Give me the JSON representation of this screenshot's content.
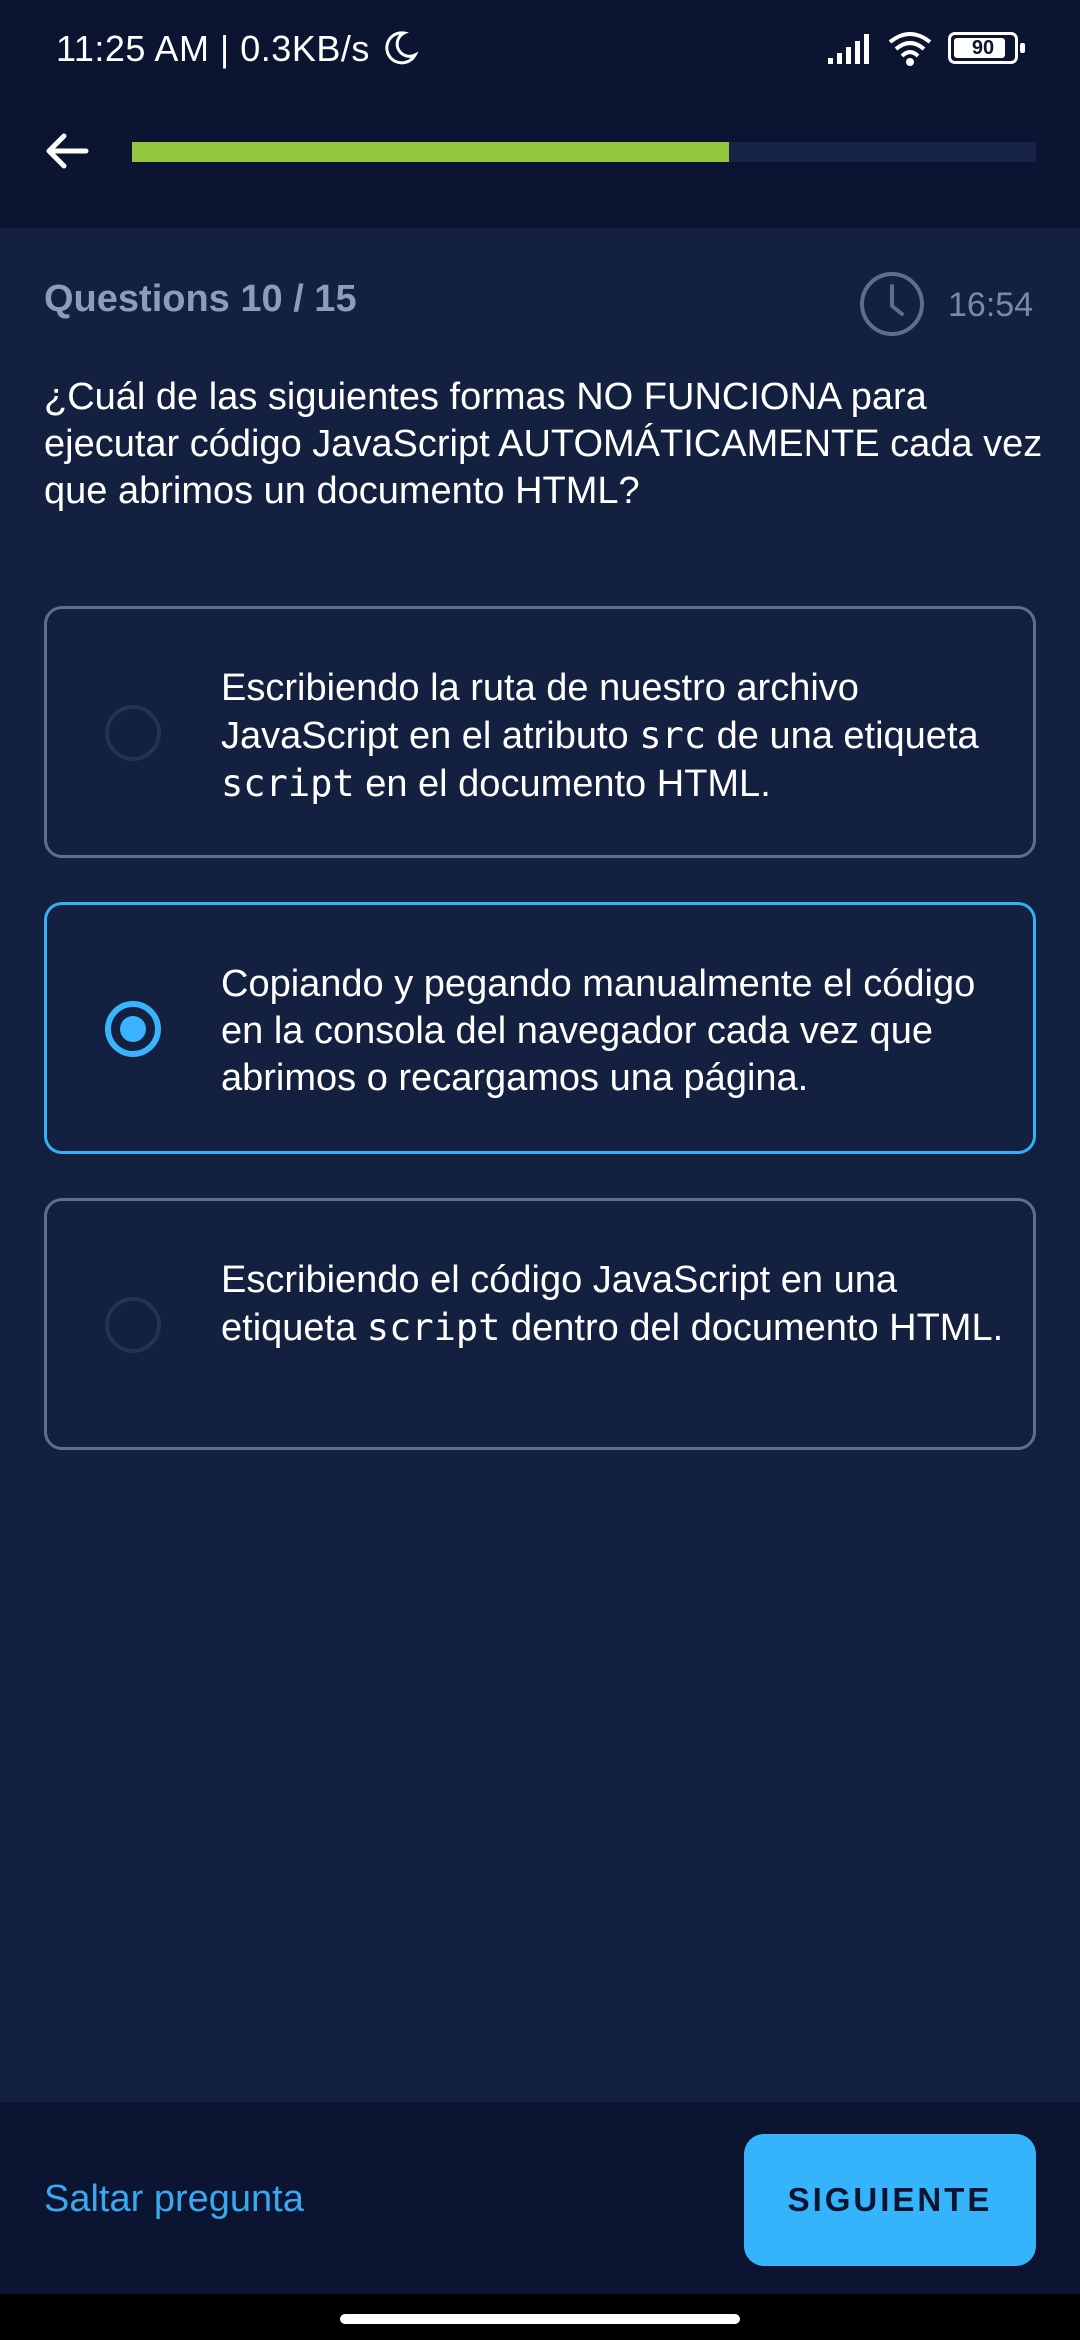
{
  "status_bar": {
    "time_speed": "11:25 AM | 0.3KB/s",
    "battery": "90",
    "icons": [
      "moon-icon",
      "signal-icon",
      "wifi-icon",
      "battery-icon"
    ]
  },
  "header": {
    "back_icon": "arrow-left-icon",
    "progress_fraction": 0.66,
    "progress_color": "#93c83e"
  },
  "quiz": {
    "counter": "Questions 10 / 15",
    "timer": "16:54",
    "question": "¿Cuál de las siguientes formas NO FUNCIONA para ejecutar código JavaScript AUTOMÁTICAMENTE cada vez que abrimos un documento HTML?",
    "options": [
      {
        "parts": [
          "Escribiendo la ruta de nuestro archivo JavaScript en el atributo ",
          "src",
          " de una etiqueta ",
          "script",
          " en el documento HTML."
        ],
        "selected": false
      },
      {
        "parts": [
          "Copiando y pegando manualmente el código en la consola del navegador cada vez que abrimos o recargamos una página."
        ],
        "selected": true
      },
      {
        "parts": [
          "Escribiendo el código JavaScript en una etiqueta ",
          "script",
          " dentro del documento HTML."
        ],
        "selected": false
      }
    ]
  },
  "footer": {
    "skip_label": "Saltar pregunta",
    "next_label": "SIGUIENTE"
  },
  "colors": {
    "background": "#13203f",
    "header": "#0b1430",
    "accent": "#35b4fb",
    "progress": "#93c83e"
  }
}
